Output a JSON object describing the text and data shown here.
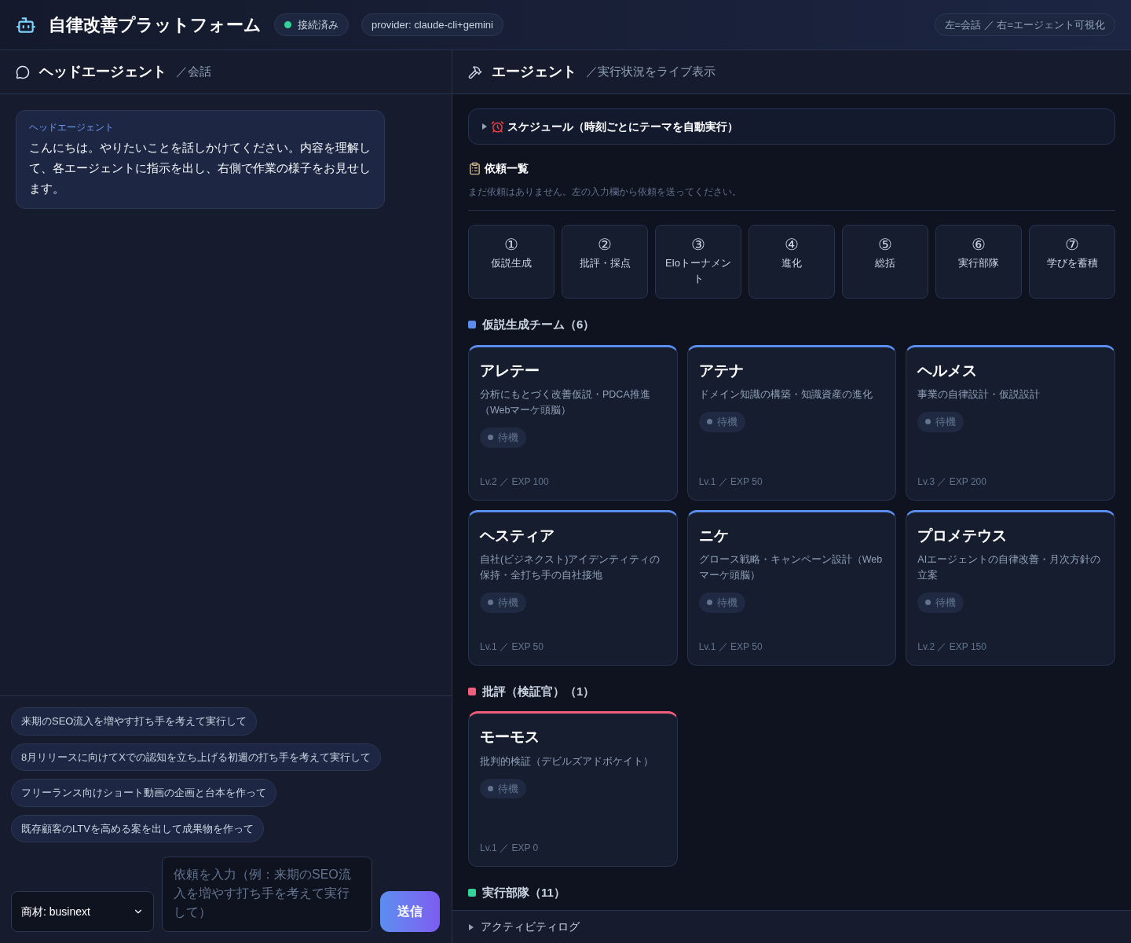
{
  "header": {
    "title": "自律改善プラットフォーム",
    "connection": {
      "label": "接続済み",
      "connected": true
    },
    "provider": "provider: claude-cli+gemini",
    "hint": "左=会話 ／ 右=エージェント可視化"
  },
  "chat": {
    "title": "ヘッドエージェント",
    "subtitle": "／会話",
    "messages": [
      {
        "sender": "ヘッドエージェント",
        "text": "こんにちは。やりたいことを話しかけてください。内容を理解して、各エージェントに指示を出し、右側で作業の様子をお見せします。"
      }
    ],
    "suggestions": [
      "来期のSEO流入を増やす打ち手を考えて実行して",
      "8月リリースに向けてXでの認知を立ち上げる初週の打ち手を考えて実行して",
      "フリーランス向けショート動画の企画と台本を作って",
      "既存顧客のLTVを高める案を出して成果物を作って"
    ],
    "product_select": "商材: businext",
    "input": {
      "placeholder": "依頼を入力（例：来期のSEO流入を増やす打ち手を考えて実行して）"
    },
    "send": "送信"
  },
  "agents_panel": {
    "title": "エージェント",
    "subtitle": "／実行状況をライブ表示",
    "schedule": {
      "label": "スケジュール（時刻ごとにテーマを自動実行）",
      "expanded": false
    },
    "requests": {
      "title": "依頼一覧",
      "empty": "まだ依頼はありません。左の入力欄から依頼を送ってください。"
    },
    "pipeline": [
      {
        "number": "①",
        "label": "仮説生成"
      },
      {
        "number": "②",
        "label": "批評・採点"
      },
      {
        "number": "③",
        "label": "Eloトーナメント"
      },
      {
        "number": "④",
        "label": "進化"
      },
      {
        "number": "⑤",
        "label": "総括"
      },
      {
        "number": "⑥",
        "label": "実行部隊"
      },
      {
        "number": "⑦",
        "label": "学びを蓄積"
      }
    ],
    "groups": [
      {
        "title": "仮説生成チーム（6）",
        "color": "#5b8def",
        "agents": [
          {
            "name": "アレテー",
            "role": "分析にもとづく改善仮説・PDCA推進（Webマーケ頭脳）",
            "status": "待機",
            "stats": "Lv.2 ／ EXP 100"
          },
          {
            "name": "アテナ",
            "role": "ドメイン知識の構築・知識資産の進化",
            "status": "待機",
            "stats": "Lv.1 ／ EXP 50"
          },
          {
            "name": "ヘルメス",
            "role": "事業の自律設計・仮説設計",
            "status": "待機",
            "stats": "Lv.3 ／ EXP 200"
          },
          {
            "name": "ヘスティア",
            "role": "自社(ビジネクスト)アイデンティティの保持・全打ち手の自社接地",
            "status": "待機",
            "stats": "Lv.1 ／ EXP 50"
          },
          {
            "name": "ニケ",
            "role": "グロース戦略・キャンペーン設計（Webマーケ頭脳）",
            "status": "待機",
            "stats": "Lv.1 ／ EXP 50"
          },
          {
            "name": "プロメテウス",
            "role": "AIエージェントの自律改善・月次方針の立案",
            "status": "待機",
            "stats": "Lv.2 ／ EXP 150"
          }
        ]
      },
      {
        "title": "批評（検証官）（1）",
        "color": "#f0607a",
        "agents": [
          {
            "name": "モーモス",
            "role": "批判的検証（デビルズアドボケイト）",
            "status": "待機",
            "stats": "Lv.1 ／ EXP 0"
          }
        ]
      },
      {
        "title": "実行部隊（11）",
        "color": "#34d399"
      }
    ]
  },
  "activity_log": {
    "label": "アクティビティログ",
    "expanded": false
  }
}
